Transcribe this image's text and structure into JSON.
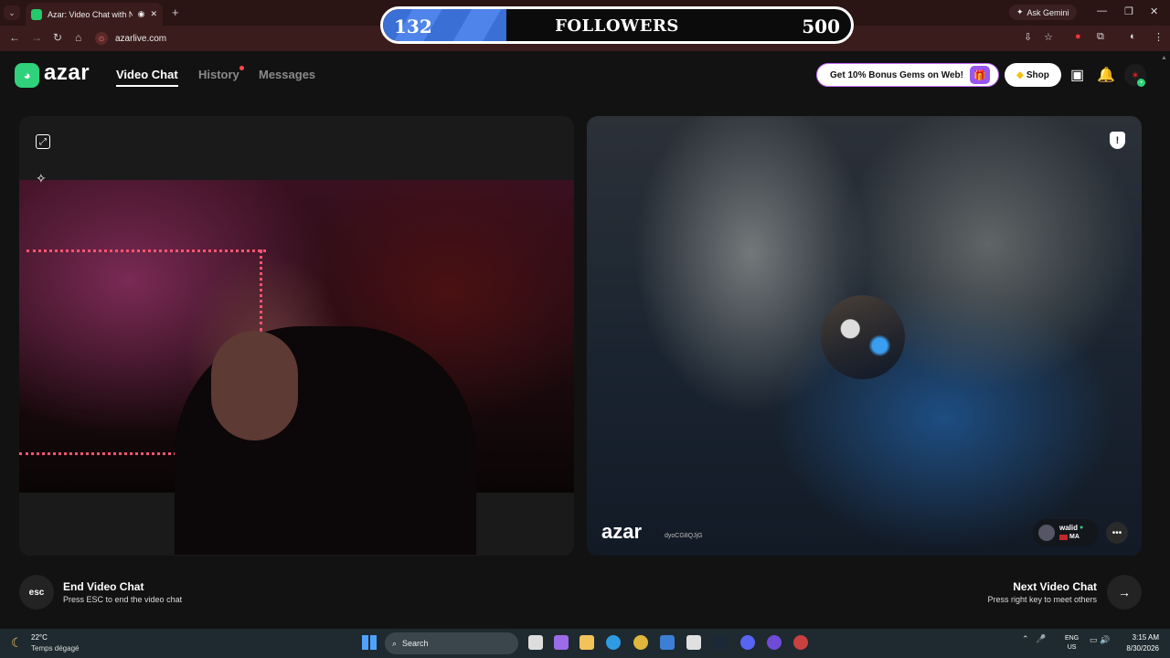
{
  "browser": {
    "tab_title": "Azar: Video Chat with New",
    "url": "azarlive.com",
    "ask_gemini": "Ask Gemini"
  },
  "followers": {
    "current": "132",
    "label": "FOLLOWERS",
    "goal": "500",
    "progress_fraction": 0.264,
    "fill_color": "#3a6fd6"
  },
  "header": {
    "logo": "azar",
    "nav": {
      "video_chat": "Video Chat",
      "history": "History",
      "messages": "Messages"
    },
    "promo": "Get 10% Bonus Gems on Web!",
    "shop": "Shop"
  },
  "video": {
    "watermark": "azar",
    "watermark_id": "dyoCG8QJjG",
    "partner": {
      "name": "walid",
      "country": "MA"
    }
  },
  "controls": {
    "esc_key": "esc",
    "end_title": "End Video Chat",
    "end_sub": "Press ESC to end the video chat",
    "next_title": "Next Video Chat",
    "next_sub": "Press right key to meet others"
  },
  "taskbar": {
    "weather_temp": "22°C",
    "weather_desc": "Temps dégagé",
    "search": "Search",
    "lang_1": "ENG",
    "lang_2": "US",
    "time": "3:15 AM",
    "date": "8/30/2026"
  },
  "colors": {
    "brand_green": "#2fd27a",
    "background": "#121212"
  }
}
